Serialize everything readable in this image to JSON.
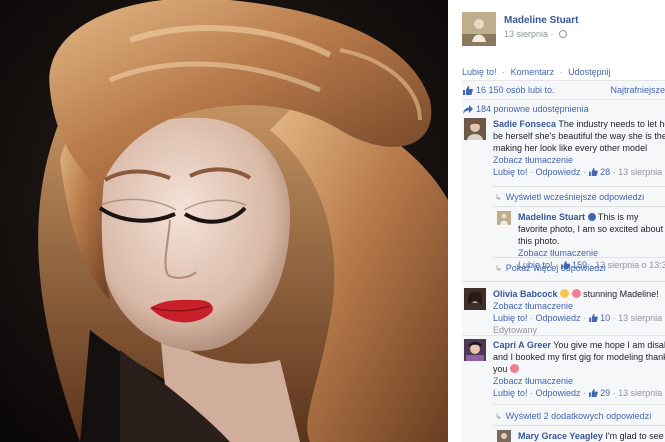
{
  "post": {
    "page_name": "Madeline Stuart",
    "date": "13 sierpnia",
    "date_sep": "·",
    "actions": {
      "like": "Lubię to!",
      "comment": "Komentarz",
      "share": "Udostępnij",
      "sep": "·"
    },
    "likes": "16 150 osób lubi to.",
    "sort": "Najtrafniejsze",
    "shares": "184 ponowne udostępnienia"
  },
  "comments": [
    {
      "author": "Sadie Fonseca",
      "text": "The industry needs to let her be herself she's beautiful the way she is their making her look like every other model",
      "translate": "Zobacz tłumaczenie",
      "like": "Lubię to!",
      "reply": "Odpowiedz",
      "count": "28",
      "time": "13 sierpnia o 05:29",
      "earlier": "Wyświetl wcześniejsze odpowiedzi",
      "reply_item": {
        "author": "Madeline Stuart",
        "text": "This is my favorite photo, I am so excited about this photo.",
        "translate": "Zobacz tłumaczenie",
        "like": "Lubię to!",
        "count": "159",
        "time": "13 sierpnia o 13:36"
      },
      "more": "Pokaż więcej odpowiedzi"
    },
    {
      "author": "Olivia Babcock",
      "text": "stunning Madeline!",
      "translate": "Zobacz tłumaczenie",
      "like": "Lubię to!",
      "reply": "Odpowiedz",
      "count": "10",
      "time": "13 sierpnia o 05:31",
      "edited": "Edytowany"
    },
    {
      "author": "Capri A Greer",
      "text": "You give me hope I am disabled and I booked my first gig for modeling thank you",
      "translate": "Zobacz tłumaczenie",
      "like": "Lubię to!",
      "reply": "Odpowiedz",
      "count": "29",
      "time": "13 sierpnia o 05:40",
      "more": "Wyświetl 2 dodatkowych odpowiedzi"
    },
    {
      "author": "Mary Grace Yeagley",
      "text": "I'm glad to see that"
    }
  ],
  "colors": {
    "link": "#4267b2",
    "author": "#365899",
    "meta": "#90949c",
    "panel_bg": "#f6f7f9"
  }
}
